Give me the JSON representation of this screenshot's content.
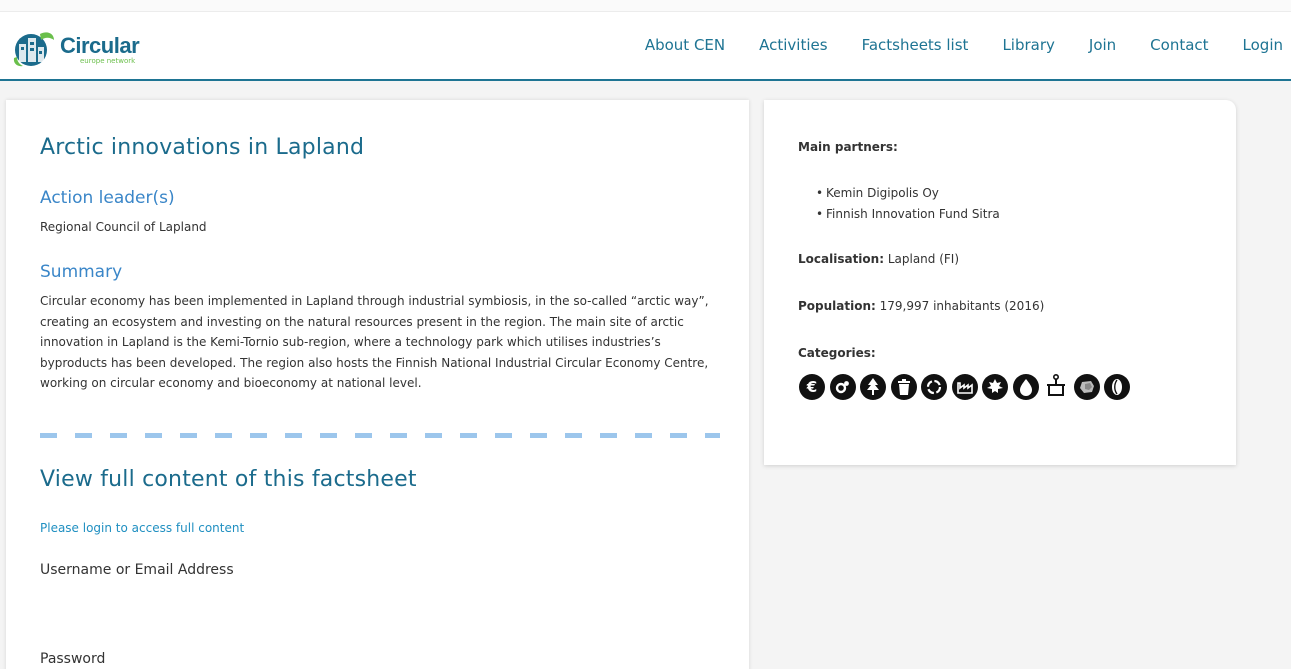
{
  "header": {
    "logo_title": "Circular",
    "logo_subtitle": "europe network",
    "nav": [
      "About CEN",
      "Activities",
      "Factsheets list",
      "Library",
      "Join",
      "Contact",
      "Login"
    ]
  },
  "main": {
    "title": "Arctic innovations in Lapland",
    "action_leader_heading": "Action leader(s)",
    "action_leader": "Regional Council of Lapland",
    "summary_heading": "Summary",
    "summary_text": "Circular economy has been implemented in Lapland through industrial symbiosis, in the so-called “arctic way”, creating an ecosystem and investing on the natural resources present in the region. The main site of arctic innovation in Lapland is the Kemi-Tornio sub-region, where a technology park which utilises industries’s byproducts has been developed. The region also hosts the Finnish National Industrial Circular Economy Centre, working on circular economy and bioeconomy at national level.",
    "full_content_heading": "View full content of this factsheet",
    "login_prompt": "Please login to access full content",
    "username_label": "Username or Email Address",
    "password_label": "Password"
  },
  "sidebar": {
    "partners_label": "Main partners:",
    "partners": [
      "Kemin Digipolis Oy",
      "Finnish Innovation Fund Sitra"
    ],
    "localisation_label": "Localisation:",
    "localisation_value": " Lapland (FI)",
    "population_label": "Population:",
    "population_value": " 179,997 inhabitants (2016)",
    "categories_label": "Categories:",
    "category_icons": [
      "euro-icon",
      "gears-icon",
      "tree-icon",
      "bin-icon",
      "recycle-icon",
      "factory-icon",
      "leaf-icon",
      "water-icon",
      "tap-icon",
      "stone-icon",
      "seed-icon"
    ],
    "euro_glyph": "€"
  },
  "colors": {
    "brand": "#1b6b8c",
    "nav_link": "#1e7493",
    "heading_accent": "#3a86c8",
    "dash": "#9cc6ec",
    "link": "#1f8fc1"
  }
}
